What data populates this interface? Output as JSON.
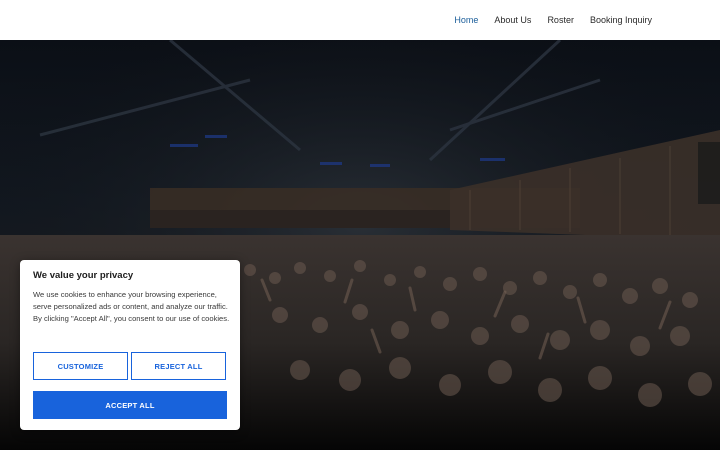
{
  "nav": {
    "items": [
      {
        "label": "Home",
        "active": true
      },
      {
        "label": "About Us",
        "active": false
      },
      {
        "label": "Roster",
        "active": false
      },
      {
        "label": "Booking Inquiry",
        "active": false
      }
    ]
  },
  "cookie_banner": {
    "title": "We value your privacy",
    "text": "We use cookies to enhance your browsing experience, serve personalized ads or content, and analyze our traffic. By clicking \"Accept All\", you consent to our use of cookies.",
    "customize_label": "CUSTOMIZE",
    "reject_label": "REJECT ALL",
    "accept_label": "ACCEPT ALL"
  },
  "colors": {
    "accent": "#1863dc",
    "nav_active": "#1b5e9a"
  }
}
